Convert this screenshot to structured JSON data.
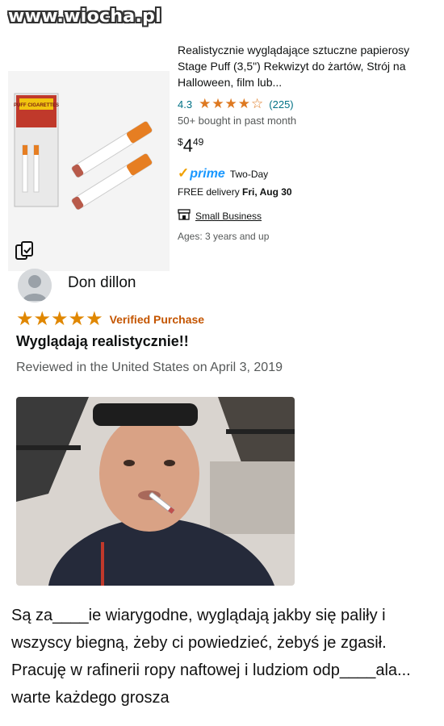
{
  "watermark": "www.wiocha.pl",
  "product": {
    "title": "Realistycznie wyglądające sztuczne papierosy Stage Puff (3,5\") Rekwizyt do żartów, Strój na Halloween, film lub...",
    "rating": "4.3",
    "stars": "★★★★☆",
    "review_count": "(225)",
    "bought": "50+ bought in past month",
    "price_dollar": "$",
    "price_whole": "4",
    "price_cents": "49",
    "prime_check": "✓",
    "prime_logo": "prime",
    "prime_text": "Two-Day",
    "delivery_prefix": "FREE delivery ",
    "delivery_date": "Fri, Aug 30",
    "small_business": "Small Business",
    "ages": "Ages: 3 years and up",
    "package_label": "PUFF CIGARETTES"
  },
  "review": {
    "reviewer": "Don dillon",
    "stars": "★★★★★",
    "verified": "Verified Purchase",
    "title": "Wyglądają realistycznie!!",
    "date": "Reviewed in the United States on April 3, 2019",
    "text": "Są za____ie wiarygodne, wyglądają jakby się paliły i wszyscy biegną, żeby ci powiedzieć, żebyś je zgasił. Pracuję w rafinerii ropy naftowej i ludziom odp____ala... warte każdego grosza"
  },
  "icons": {
    "compare": "compare-icon",
    "store": "store-icon",
    "avatar": "avatar-icon"
  },
  "colors": {
    "link": "#007185",
    "star": "#de7921",
    "verified": "#c45500",
    "prime": "#1a98ff"
  }
}
